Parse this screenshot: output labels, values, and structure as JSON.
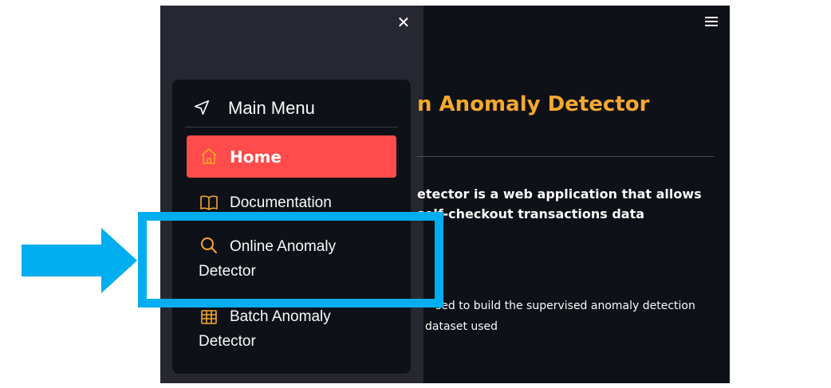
{
  "sidebar": {
    "close_icon": "close-icon",
    "menu_title": "Main Menu",
    "menu_icon": "navigation-icon",
    "items": [
      {
        "label": "Home",
        "icon": "home-icon",
        "active": true
      },
      {
        "label": "Documentation",
        "icon": "book-icon"
      },
      {
        "label_line1": "Online Anomaly",
        "label_line2": "Detector",
        "icon": "search-icon"
      },
      {
        "label_line1": "Batch Anomaly",
        "label_line2": "Detector",
        "icon": "table-icon"
      }
    ]
  },
  "main": {
    "title_visible": "n Anomaly Detector",
    "intro_line1": "etector is a web application that allows",
    "intro_line2": "self-checkout transactions data",
    "text_line1": "sed to build the supervised anomaly detection",
    "text_line2": "dataset used",
    "menu_icon": "hamburger-icon"
  },
  "colors": {
    "accent": "#ff4b4b",
    "title": "#f6a82e",
    "icon_orange": "#f6a82e",
    "annotation": "#00adee",
    "background": "#0e1117",
    "sidebar_bg": "#262730"
  }
}
